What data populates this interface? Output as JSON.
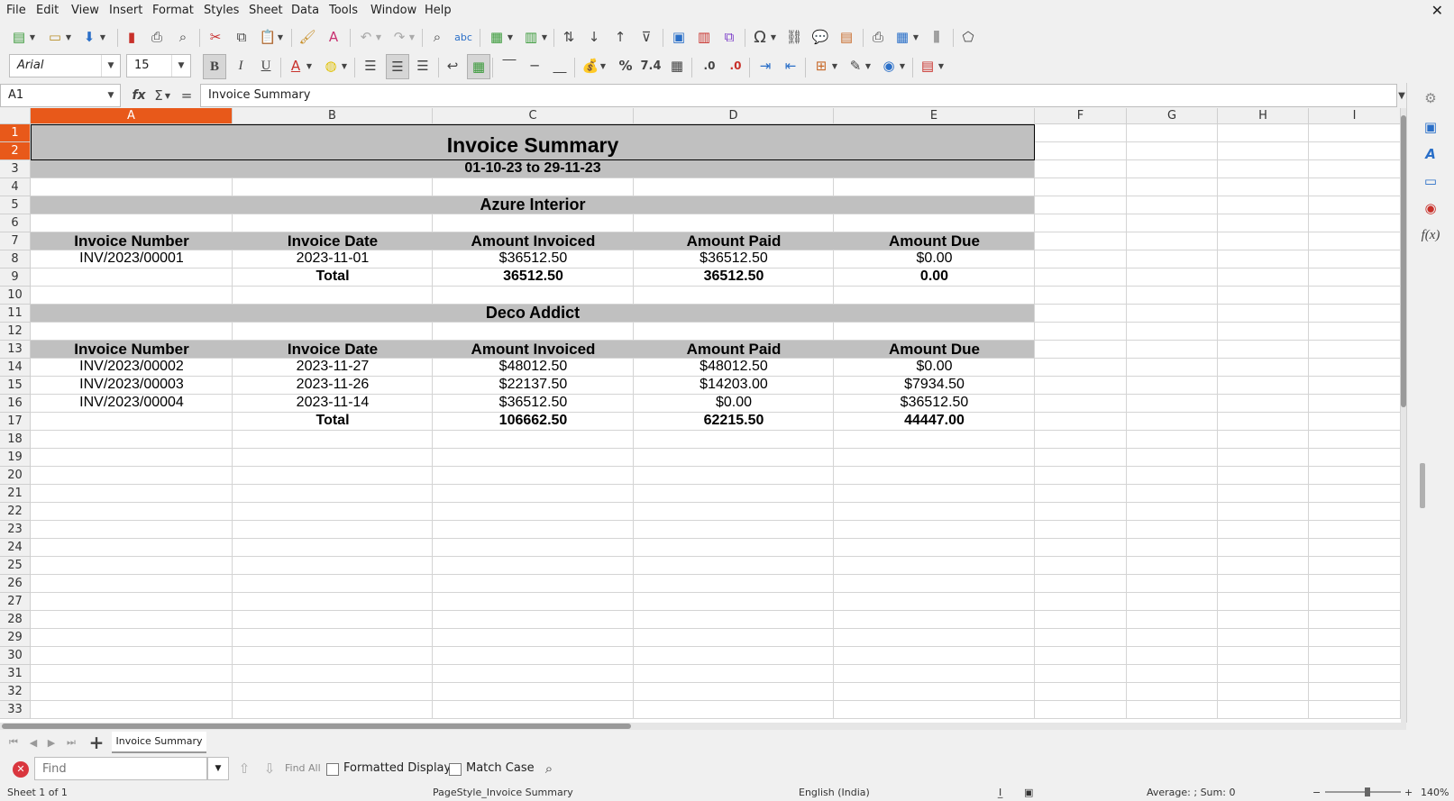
{
  "menu": [
    "File",
    "Edit",
    "View",
    "Insert",
    "Format",
    "Styles",
    "Sheet",
    "Data",
    "Tools",
    "Window",
    "Help"
  ],
  "font_name": "Arial",
  "font_size": "15",
  "name_box": "A1",
  "formula_value": "Invoice Summary",
  "columns": [
    "A",
    "B",
    "C",
    "D",
    "E",
    "F",
    "G",
    "H",
    "I"
  ],
  "rows": [
    "1",
    "2",
    "3",
    "4",
    "5",
    "6",
    "7",
    "8",
    "9",
    "10",
    "11",
    "12",
    "13",
    "14",
    "15",
    "16",
    "17",
    "18",
    "19",
    "20",
    "21",
    "22",
    "23",
    "24",
    "25",
    "26",
    "27",
    "28",
    "29",
    "30",
    "31",
    "32",
    "33"
  ],
  "sheet": {
    "title": "Invoice Summary",
    "date_range": "01-10-23 to 29-11-23",
    "customers": [
      {
        "name": "Azure Interior",
        "headers": [
          "Invoice Number",
          "Invoice Date",
          "Amount Invoiced",
          "Amount Paid",
          "Amount Due"
        ],
        "rows": [
          [
            "INV/2023/00001",
            "2023-11-01",
            "$36512.50",
            "$36512.50",
            "$0.00"
          ]
        ],
        "total_label": "Total",
        "totals": [
          "36512.50",
          "36512.50",
          "0.00"
        ]
      },
      {
        "name": "Deco Addict",
        "headers": [
          "Invoice Number",
          "Invoice Date",
          "Amount Invoiced",
          "Amount Paid",
          "Amount Due"
        ],
        "rows": [
          [
            "INV/2023/00002",
            "2023-11-27",
            "$48012.50",
            "$48012.50",
            "$0.00"
          ],
          [
            "INV/2023/00003",
            "2023-11-26",
            "$22137.50",
            "$14203.00",
            "$7934.50"
          ],
          [
            "INV/2023/00004",
            "2023-11-14",
            "$36512.50",
            "$0.00",
            "$36512.50"
          ]
        ],
        "total_label": "Total",
        "totals": [
          "106662.50",
          "62215.50",
          "44447.00"
        ]
      }
    ]
  },
  "sheet_tab": "Invoice Summary",
  "find": {
    "placeholder": "Find",
    "find_all": "Find All",
    "formatted_display": "Formatted Display",
    "match_case": "Match Case"
  },
  "status": {
    "sheet_pos": "Sheet 1 of 1",
    "page_style": "PageStyle_Invoice Summary",
    "language": "English (India)",
    "sum": "Average: ; Sum: 0",
    "zoom": "140%"
  },
  "colors": {
    "header_gray": "#c0c0c0",
    "active_col": "#e8591a"
  }
}
